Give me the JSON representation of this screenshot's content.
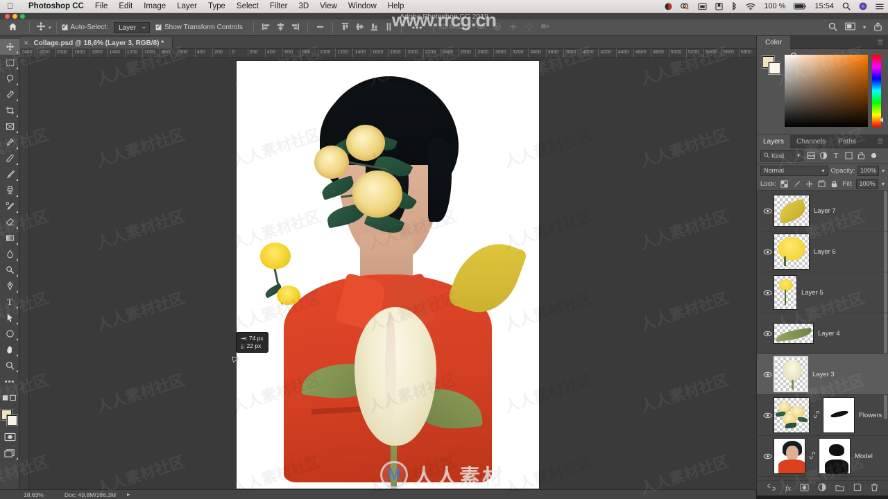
{
  "macbar": {
    "apple_icon": "apple-icon",
    "app_name": "Photoshop CC",
    "menus": [
      "File",
      "Edit",
      "Image",
      "Layer",
      "Type",
      "Select",
      "Filter",
      "3D",
      "View",
      "Window",
      "Help"
    ],
    "status": {
      "battery_percent": "100 %",
      "time": "15:54",
      "icons": [
        "user-icon",
        "dropbox-icon",
        "display-icon",
        "archive-icon",
        "bluetooth-icon",
        "wifi-icon",
        "battery-icon",
        "search-icon",
        "siri-icon",
        "notification-center-icon"
      ]
    }
  },
  "window": {
    "title": "Adobe Photoshop CC 2019",
    "traffic_lights": [
      "close-button",
      "minimize-button",
      "zoom-button"
    ]
  },
  "options_bar": {
    "home_icon": "home-icon",
    "tool_icon": "move-tool-icon",
    "auto_select_label": "Auto-Select:",
    "auto_select_checked": true,
    "auto_select_value": "Layer",
    "show_transform_label": "Show Transform Controls",
    "show_transform_checked": true,
    "align_group_1": [
      "align-left-edges-icon",
      "align-horizontal-centers-icon",
      "align-right-edges-icon"
    ],
    "distribute_icon": "distribute-icon",
    "align_group_2": [
      "align-top-edges-icon",
      "align-vertical-centers-icon",
      "align-bottom-edges-icon",
      "distribute-vertical-icon"
    ],
    "more_label": "•••",
    "mode3d_label": "3D Mode:",
    "mode3d_icons": [
      "orbit-3d-icon",
      "roll-3d-icon",
      "pan-3d-icon",
      "slide-3d-icon",
      "camera-3d-icon"
    ],
    "right_icons": [
      "search-icon",
      "workspace-icon",
      "chevron-down-icon",
      "share-icon"
    ]
  },
  "document": {
    "tab_title": "Collage.psd @ 18,6% (Layer 3, RGB/8) *",
    "close_icon": "close-icon"
  },
  "rulers": {
    "h_ticks": [
      "2400",
      "2200",
      "2000",
      "1800",
      "1600",
      "1400",
      "1200",
      "1000",
      "800",
      "600",
      "400",
      "200",
      "0",
      "200",
      "400",
      "600",
      "800",
      "1000",
      "1200",
      "1400",
      "1600",
      "1800",
      "2000",
      "2200",
      "2400",
      "2600",
      "2800",
      "3000",
      "3200",
      "3400",
      "3600",
      "3800",
      "4000",
      "4200",
      "4400",
      "4600",
      "4800",
      "5000",
      "5200",
      "5400",
      "5600",
      "5800"
    ]
  },
  "toolbar": {
    "tools": [
      {
        "name": "move-tool",
        "glyph": "✛",
        "active": true
      },
      {
        "name": "marquee-tool",
        "glyph": "⬚",
        "active": false
      },
      {
        "name": "lasso-tool",
        "glyph": "⌒",
        "active": false
      },
      {
        "name": "magic-wand-tool",
        "glyph": "✦",
        "active": false
      },
      {
        "name": "crop-tool",
        "glyph": "⌗",
        "active": false
      },
      {
        "name": "frame-tool",
        "glyph": "⊠",
        "active": false
      },
      {
        "name": "eyedropper-tool",
        "glyph": "✒",
        "active": false
      },
      {
        "name": "healing-brush-tool",
        "glyph": "❀",
        "active": false
      },
      {
        "name": "brush-tool",
        "glyph": "✐",
        "active": false
      },
      {
        "name": "clone-stamp-tool",
        "glyph": "⚓",
        "active": false
      },
      {
        "name": "history-brush-tool",
        "glyph": "✎",
        "active": false
      },
      {
        "name": "eraser-tool",
        "glyph": "◫",
        "active": false
      },
      {
        "name": "gradient-tool",
        "glyph": "◧",
        "active": false
      },
      {
        "name": "blur-tool",
        "glyph": "●",
        "active": false
      },
      {
        "name": "dodge-tool",
        "glyph": "◔",
        "active": false
      },
      {
        "name": "pen-tool",
        "glyph": "✑",
        "active": false
      },
      {
        "name": "type-tool",
        "glyph": "T",
        "active": false
      },
      {
        "name": "path-selection-tool",
        "glyph": "➤",
        "active": false
      },
      {
        "name": "shape-tool",
        "glyph": "○",
        "active": false
      },
      {
        "name": "hand-tool",
        "glyph": "✋",
        "active": false
      },
      {
        "name": "zoom-tool",
        "glyph": "⌕",
        "active": false
      },
      {
        "name": "edit-toolbar",
        "glyph": "•••",
        "active": false
      }
    ],
    "quick_mask_icon": "quick-mask-icon",
    "screen_mode_icon": "screen-mode-icon",
    "foreground_color": "#f2e4b8",
    "background_color": "#f6f2e6"
  },
  "color_panel": {
    "tab": "Color",
    "menu_icon": "panel-menu-icon",
    "foreground_color": "#f3e5b9",
    "background_color": "#fbf7ec",
    "field_hue": "#ff7a00"
  },
  "layers_panel": {
    "tabs": [
      "Layers",
      "Channels",
      "Paths"
    ],
    "active_tab": "Layers",
    "menu_icon": "panel-menu-icon",
    "filter": {
      "search_icon": "search-icon",
      "kind_label": "Kind",
      "filter_icons": [
        "filter-image-icon",
        "filter-adjustment-icon",
        "filter-type-icon",
        "filter-shape-icon",
        "filter-smart-object-icon"
      ],
      "toggle_icon": "filter-toggle-icon"
    },
    "blend_mode": "Normal",
    "opacity_label": "Opacity:",
    "opacity_value": "100%",
    "lock_label": "Lock:",
    "lock_icons": [
      "lock-transparent-pixels-icon",
      "lock-image-pixels-icon",
      "lock-position-icon",
      "lock-artboard-icon",
      "lock-all-icon"
    ],
    "fill_label": "Fill:",
    "fill_value": "100%",
    "layers": [
      {
        "name": "Layer 7",
        "visible": true,
        "selected": false,
        "thumb": "leaf-yellow",
        "mask": false
      },
      {
        "name": "Layer 6",
        "visible": true,
        "selected": false,
        "thumb": "flower-yellow",
        "mask": false
      },
      {
        "name": "Layer 5",
        "visible": true,
        "selected": false,
        "thumb": "flower-small",
        "mask": false
      },
      {
        "name": "Layer 4",
        "visible": true,
        "selected": false,
        "thumb": "leaf-green",
        "mask": false
      },
      {
        "name": "Layer 3",
        "visible": true,
        "selected": true,
        "thumb": "tulip-white",
        "mask": false
      },
      {
        "name": "Flowers",
        "visible": true,
        "selected": false,
        "thumb": "roses",
        "mask": true
      },
      {
        "name": "Model",
        "visible": true,
        "selected": false,
        "thumb": "model-portrait",
        "mask": true
      }
    ],
    "footer_icons": [
      "link-layers-icon",
      "add-layer-style-icon",
      "add-layer-mask-icon",
      "new-adjustment-layer-icon",
      "new-group-icon",
      "new-layer-icon",
      "delete-layer-icon"
    ]
  },
  "canvas_hud": {
    "delta_x": "⇥: 74 px",
    "delta_y": "⤓: 22 px",
    "cursor_icon": "move-cursor-icon"
  },
  "status_bar": {
    "zoom": "18,63%",
    "doc_label": "Doc: 49,8M/166,3M",
    "arrow_icon": "chevron-right-icon"
  },
  "watermarks": {
    "top_url": "www.rrcg.cn",
    "center_logo": "M",
    "center_text": "人人素材",
    "tile_text": "人人素材社区"
  }
}
